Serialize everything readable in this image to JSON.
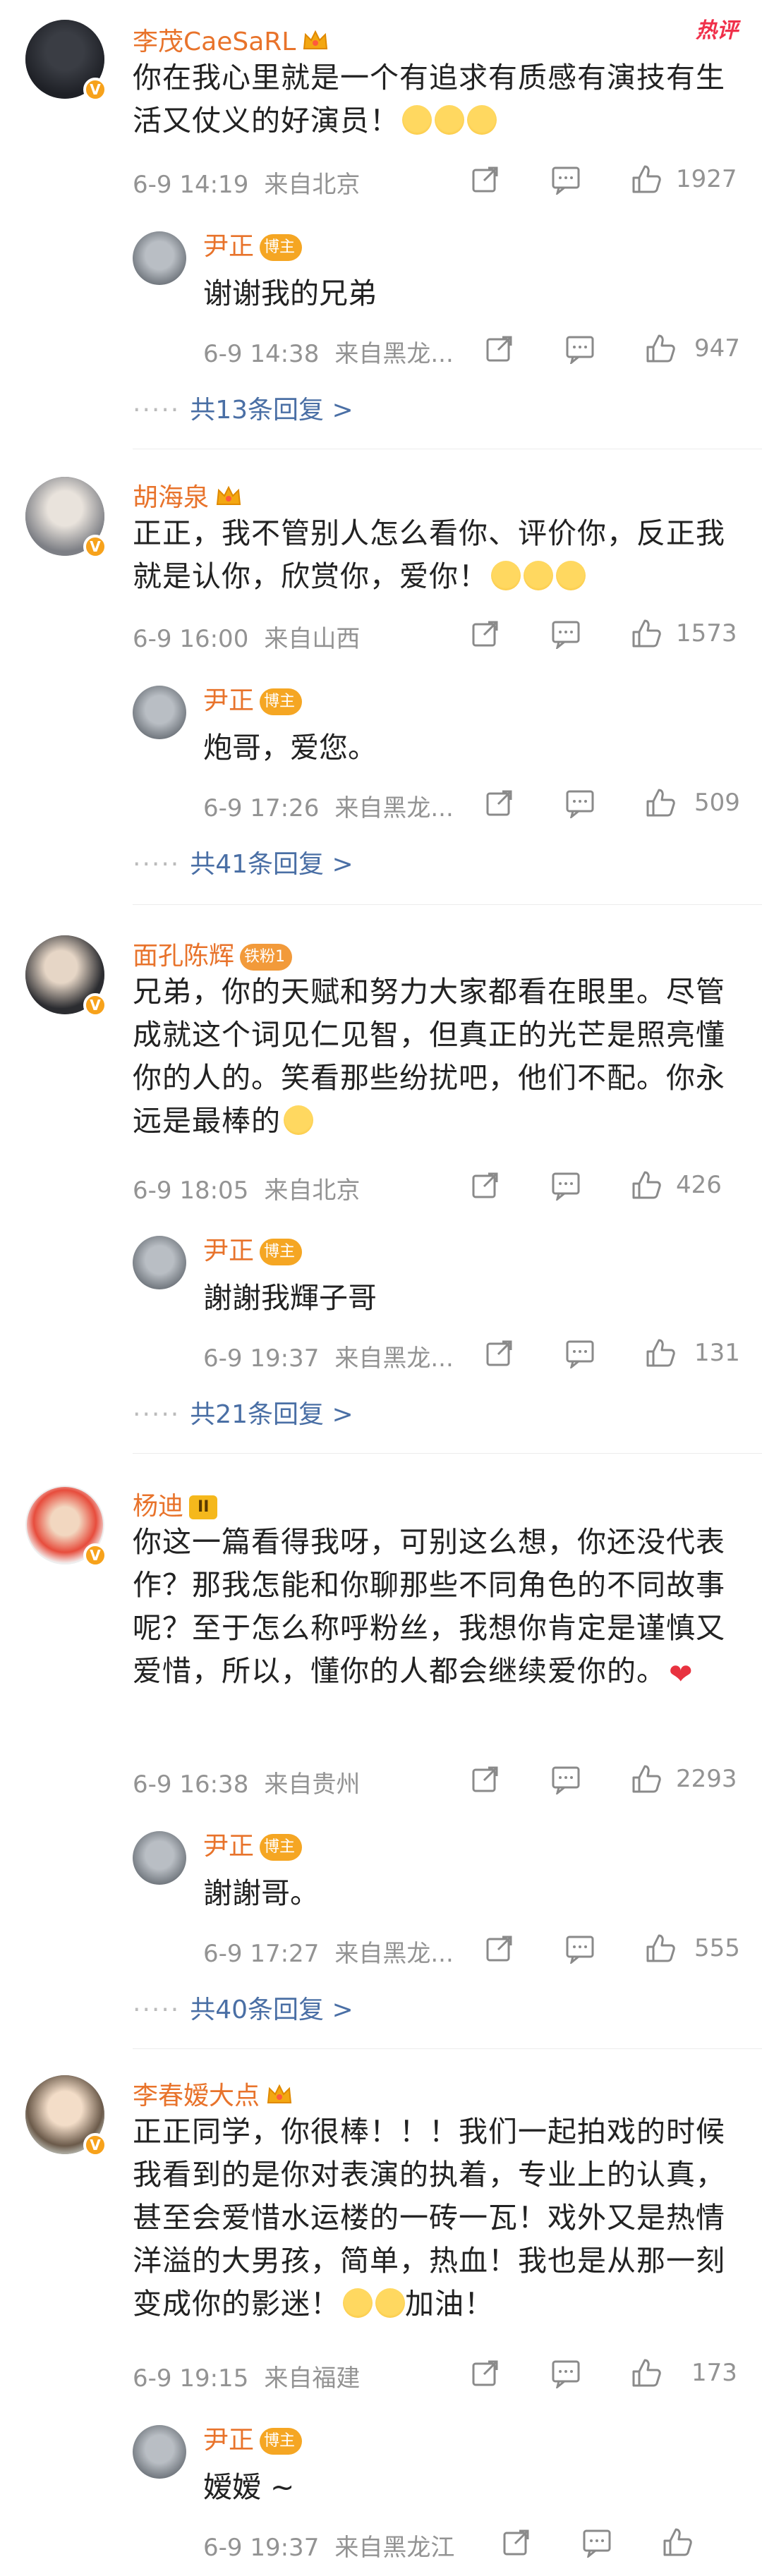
{
  "comments": [
    {
      "user": "李茂CaeSaRL",
      "hot_tag": "热评",
      "text": "你在我心里就是一个有追求有质感有演技有生活又仗义的好演员！",
      "emoji_count": 3,
      "time": "6-9 14:19",
      "location": "来自北京",
      "likes": "1927",
      "reply": {
        "user": "尹正",
        "badge": "博主",
        "text": "谢谢我的兄弟",
        "time": "6-9 14:38",
        "location": "来自黑龙...",
        "likes": "947"
      },
      "more_replies": "共13条回复 >"
    },
    {
      "user": "胡海泉",
      "text": "正正，我不管别人怎么看你、评价你，反正我就是认你，欣赏你，爱你！",
      "emoji_count": 3,
      "time": "6-9 16:00",
      "location": "来自山西",
      "likes": "1573",
      "reply": {
        "user": "尹正",
        "badge": "博主",
        "text": "炮哥，爱您。",
        "time": "6-9 17:26",
        "location": "来自黑龙...",
        "likes": "509"
      },
      "more_replies": "共41条回复 >"
    },
    {
      "user": "面孔陈辉",
      "fan_badge": "铁粉1",
      "text": "兄弟，你的天赋和努力大家都看在眼里。尽管成就这个词见仁见智，但真正的光芒是照亮懂你的人的。笑看那些纷扰吧，他们不配。你永远是最棒的",
      "emoji_count": 1,
      "time": "6-9 18:05",
      "location": "来自北京",
      "likes": "426",
      "reply": {
        "user": "尹正",
        "badge": "博主",
        "text": "謝謝我輝子哥",
        "time": "6-9 19:37",
        "location": "来自黑龙...",
        "likes": "131"
      },
      "more_replies": "共21条回复 >"
    },
    {
      "user": "杨迪",
      "level_badge": "II",
      "text": "你这一篇看得我呀，可别这么想，你还没代表作？那我怎能和你聊那些不同角色的不同故事呢？至于怎么称呼粉丝，我想你肯定是谨慎又爱惜，所以，懂你的人都会继续爱你的。",
      "heart": "❤",
      "time": "6-9 16:38",
      "location": "来自贵州",
      "likes": "2293",
      "reply": {
        "user": "尹正",
        "badge": "博主",
        "text": "謝謝哥。",
        "time": "6-9 17:27",
        "location": "来自黑龙...",
        "likes": "555"
      },
      "more_replies": "共40条回复 >"
    },
    {
      "user": "李春嫒大点",
      "text": "正正同学，你很棒！！！我们一起拍戏的时候我看到的是你对表演的执着，专业上的认真，甚至会爱惜水运楼的一砖一瓦！戏外又是热情洋溢的大男孩，简单，热血！我也是从那一刻变成你的影迷！",
      "emoji_count": 2,
      "text_tail": "加油！",
      "time": "6-9 19:15",
      "location": "来自福建",
      "likes": "173",
      "reply": {
        "user": "尹正",
        "badge": "博主",
        "text": "嫒嫒 ~",
        "time": "6-9 19:37",
        "location": "来自黑龙江",
        "likes": ""
      }
    }
  ],
  "icons": {
    "share": "share-icon",
    "comment": "comment-icon",
    "like": "thumbs-up-icon",
    "crown": "crown-icon",
    "verified": "verified-icon"
  },
  "colors": {
    "username": "#e8732b",
    "meta": "#939393",
    "link": "#4a6fa5",
    "hot": "#f0304a"
  },
  "verified_mark": "V"
}
